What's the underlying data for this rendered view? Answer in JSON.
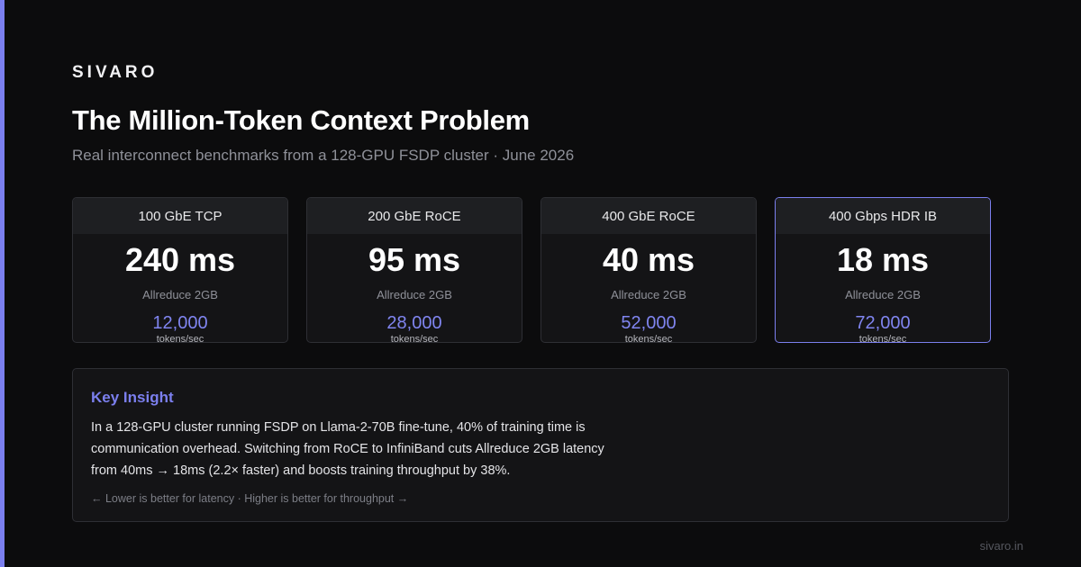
{
  "brand": "SIVARO",
  "title": "The Million-Token Context Problem",
  "subtitle": "Real interconnect benchmarks from a 128-GPU FSDP cluster · June 2026",
  "cards": [
    {
      "label": "100 GbE TCP",
      "latency": "240 ms",
      "metric": "Allreduce 2GB",
      "throughput": "12,000",
      "unit": "tokens/sec"
    },
    {
      "label": "200 GbE RoCE",
      "latency": "95 ms",
      "metric": "Allreduce 2GB",
      "throughput": "28,000",
      "unit": "tokens/sec"
    },
    {
      "label": "400 GbE RoCE",
      "latency": "40 ms",
      "metric": "Allreduce 2GB",
      "throughput": "52,000",
      "unit": "tokens/sec"
    },
    {
      "label": "400 Gbps HDR IB",
      "latency": "18 ms",
      "metric": "Allreduce 2GB",
      "throughput": "72,000",
      "unit": "tokens/sec"
    }
  ],
  "insight": {
    "title": "Key Insight",
    "body": "In a 128-GPU cluster running FSDP on Llama-2-70B fine-tune, 40% of training time is communication overhead. Switching from RoCE to InfiniBand cuts Allreduce 2GB latency from 40ms → 18ms (2.2× faster) and boosts training throughput by 38%.",
    "footnote": "← Lower is better for latency · Higher is better for throughput →"
  },
  "url": "sivaro.in",
  "colors": {
    "background": "#0c0c0d",
    "accent": "#7b7fee",
    "card_bg": "#141416",
    "card_header_bg": "#1e1f22",
    "border": "#2e2f34",
    "muted_text": "#8f9199"
  }
}
